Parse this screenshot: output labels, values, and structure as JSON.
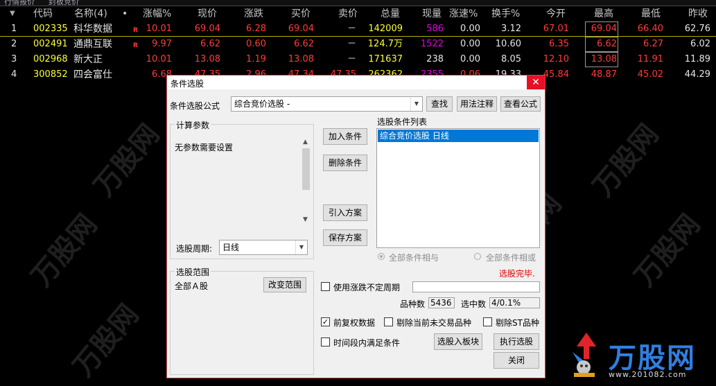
{
  "tabs": [
    "行情报价",
    "封板竞价"
  ],
  "headers": [
    "代码",
    "名称(4)",
    "•",
    "涨幅%",
    "现价",
    "涨跌",
    "买价",
    "卖价",
    "总量",
    "现量",
    "涨速%",
    "换手%",
    "今开",
    "最高",
    "最低",
    "昨收"
  ],
  "rows": [
    {
      "idx": "1",
      "code": "002335",
      "name": "科华数据",
      "badge": "R",
      "chg_pct": "10.01",
      "price": "69.04",
      "chg": "6.28",
      "bid": "69.04",
      "ask": "－",
      "vol": "142009",
      "cur_vol": "586",
      "speed": "0.00",
      "turnover": "3.12",
      "open": "67.01",
      "high": "69.04",
      "low": "66.40",
      "prev": "62.76"
    },
    {
      "idx": "2",
      "code": "002491",
      "name": "通鼎互联",
      "badge": "R",
      "chg_pct": "9.97",
      "price": "6.62",
      "chg": "0.60",
      "bid": "6.62",
      "ask": "－",
      "vol": "124.7万",
      "cur_vol": "1522",
      "speed": "0.00",
      "turnover": "10.60",
      "open": "6.35",
      "high": "6.62",
      "low": "6.27",
      "prev": "6.02"
    },
    {
      "idx": "3",
      "code": "002968",
      "name": "新大正",
      "badge": "",
      "chg_pct": "10.01",
      "price": "13.08",
      "chg": "1.19",
      "bid": "13.08",
      "ask": "－",
      "vol": "171637",
      "cur_vol": "238",
      "speed": "0.00",
      "turnover": "8.05",
      "open": "12.10",
      "high": "13.08",
      "low": "11.91",
      "prev": "11.89"
    },
    {
      "idx": "4",
      "code": "300852",
      "name": "四会富仕",
      "badge": "",
      "chg_pct": "6.68",
      "price": "47.35",
      "chg": "2.96",
      "bid": "47.34",
      "ask": "47.35",
      "vol": "262362",
      "cur_vol": "2355",
      "speed": "0.06",
      "turnover": "19.33",
      "open": "45.84",
      "high": "48.87",
      "low": "45.02",
      "prev": "44.29"
    }
  ],
  "dialog": {
    "title": "条件选股",
    "formula_label": "条件选股公式",
    "formula_value": "综合竞价选股  -",
    "find_btn": "查找",
    "usage_btn": "用法注释",
    "view_btn": "查看公式",
    "params_title": "计算参数",
    "params_text": "无参数需要设置",
    "add_btn": "加入条件",
    "del_btn": "删除条件",
    "import_btn": "引入方案",
    "save_btn": "保存方案",
    "cond_list_title": "选股条件列表",
    "cond_item": "综合竞价选股  日线",
    "period_label": "选股周期:",
    "period_value": "日线",
    "radio_and": "全部条件相与",
    "radio_or": "全部条件相或",
    "status": "选股完毕.",
    "range_title": "选股范围",
    "range_value": "全部Ａ股",
    "change_range_btn": "改变范围",
    "use_period_label": "使用涨跌不定周期",
    "count_label": "品种数",
    "count_value": "5436",
    "selected_label": "选中数",
    "selected_value": "4/0.1%",
    "rights_label": "前复权数据",
    "exclude_untraded_label": "剔除当前未交易品种",
    "exclude_st_label": "剔除ST品种",
    "time_label": "时间段内满足条件",
    "to_block_btn": "选股入板块",
    "exec_btn": "执行选股",
    "close_btn": "关闭"
  },
  "logo": {
    "text": "万股网",
    "url": "www.201082.com"
  },
  "colors": {
    "up": "#ff3b3b",
    "code": "#ffff33",
    "volume": "#ffff33",
    "cur_vol_up": "#e000e0",
    "select": "#0078d7",
    "close": "#e81123"
  }
}
